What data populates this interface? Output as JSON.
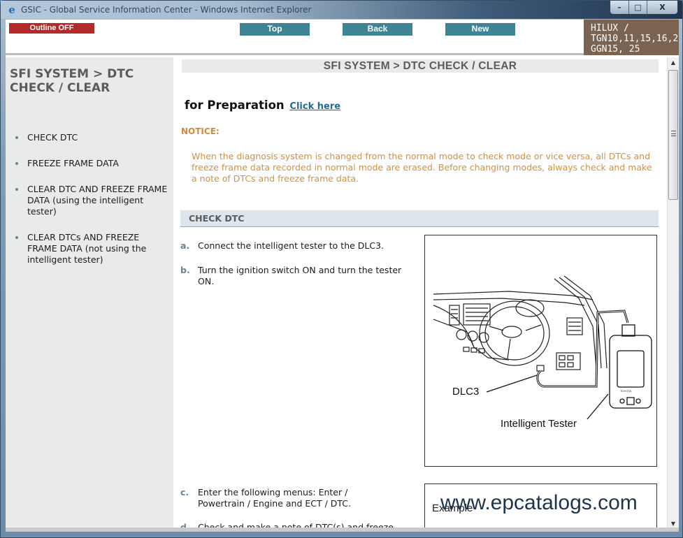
{
  "window": {
    "title": "GSIC - Global Service Information Center - Windows Internet Explorer",
    "controls": {
      "minimize": "–",
      "maximize": "□",
      "close": "X"
    }
  },
  "header": {
    "outline_button": "Outline OFF",
    "nav_buttons": [
      "Top",
      "Back",
      "New"
    ],
    "model_lines": [
      "HILUX /",
      "TGN10,11,15,16,2",
      "GGN15, 25"
    ],
    "colors": {
      "outline_button": "#b42a2a",
      "nav_button": "#3f8494",
      "model_box": "#7a6350"
    }
  },
  "sidebar": {
    "title": "SFI SYSTEM > DTC CHECK / CLEAR",
    "items": [
      "CHECK DTC",
      "FREEZE FRAME DATA",
      "CLEAR DTC AND FREEZE FRAME DATA (using the intelligent tester)",
      "CLEAR DTCs AND FREEZE FRAME DATA (not using the intelligent tester)"
    ]
  },
  "main": {
    "page_title": "SFI SYSTEM > DTC CHECK / CLEAR",
    "preparation_label": "for Preparation",
    "preparation_link": "Click here",
    "notice_label": "NOTICE:",
    "notice_text": "When the diagnosis system is changed from the normal mode to check mode or vice versa, all DTCs and freeze frame data recorded in normal mode are erased. Before changing modes, always check and make a note of DTCs and freeze frame data.",
    "section_title": "CHECK DTC",
    "steps": [
      {
        "letter": "a.",
        "text": "Connect the intelligent tester to the DLC3."
      },
      {
        "letter": "b.",
        "text": "Turn the ignition switch ON and turn the tester ON."
      },
      {
        "letter": "c.",
        "text": "Enter the following menus: Enter / Powertrain / Engine and ECT / DTC."
      },
      {
        "letter": "d.",
        "text": "Check and make a note of DTC(s) and freeze"
      }
    ],
    "figure": {
      "labels": {
        "dlc3": "DLC3",
        "tester": "Intelligent Tester"
      }
    },
    "example": {
      "label": "Example",
      "watermark": "www.epcatalogs.com"
    }
  },
  "scrollbar": {
    "up": "▲",
    "down": "▼"
  }
}
